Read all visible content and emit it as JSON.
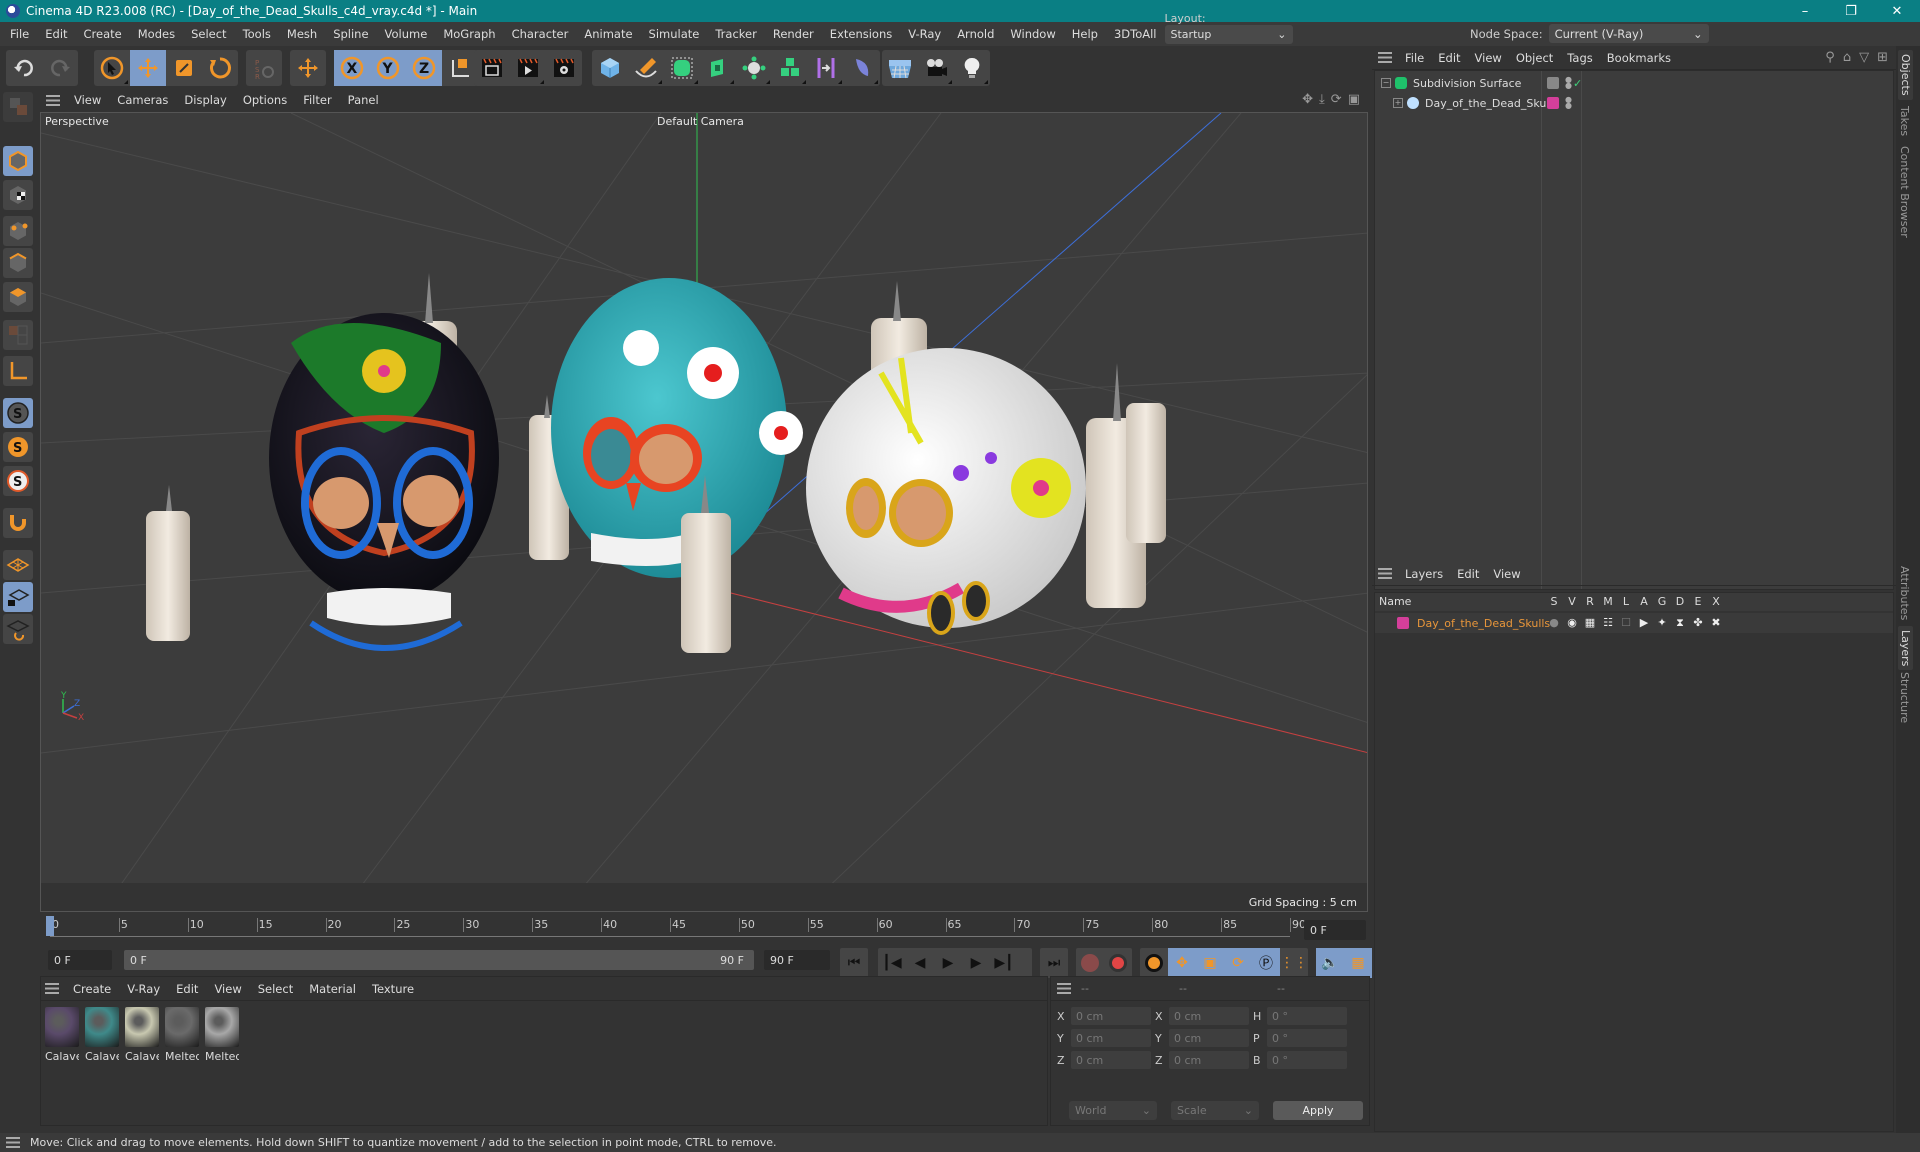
{
  "window": {
    "title": "Cinema 4D R23.008 (RC) - [Day_of_the_Dead_Skulls_c4d_vray.c4d *] - Main",
    "controls": [
      "minimize",
      "restore",
      "close"
    ]
  },
  "menubar": {
    "items": [
      "File",
      "Edit",
      "Create",
      "Modes",
      "Select",
      "Tools",
      "Mesh",
      "Spline",
      "Volume",
      "MoGraph",
      "Character",
      "Animate",
      "Simulate",
      "Tracker",
      "Render",
      "Extensions",
      "V-Ray",
      "Arnold",
      "Window",
      "Help",
      "3DToAll"
    ],
    "node_space_label": "Node Space:",
    "node_space_value": "Current (V-Ray)",
    "layout_label": "Layout:",
    "layout_value": "Startup"
  },
  "toolbar": {
    "groups": [
      [
        "undo-icon",
        "redo-icon"
      ],
      [
        "select-arrow-icon",
        "move-icon",
        "scale-icon",
        "rotate-icon"
      ],
      [
        "psr-icon"
      ],
      [
        "move-alt-icon"
      ],
      [
        "x-axis-icon",
        "y-axis-icon",
        "z-axis-icon"
      ],
      [
        "coordinate-system-icon"
      ],
      [
        "render-view-icon",
        "render-picture-viewer-icon",
        "render-settings-icon"
      ],
      [
        "cube-icon",
        "pen-spline-icon",
        "subdivision-generator-icon",
        "extrude-icon",
        "mograph-cloner-icon",
        "array-icon",
        "symmetry-deformer-icon",
        "field-icon"
      ],
      [
        "floor-icon",
        "camera-icon",
        "light-icon"
      ]
    ],
    "selected": [
      "move-icon",
      "x-axis-icon",
      "y-axis-icon",
      "z-axis-icon"
    ]
  },
  "left_tools": {
    "items": [
      "model-mode",
      "texture-mode",
      "point-mode",
      "edge-mode",
      "polygon-mode",
      "uv-mode",
      "axis-mode",
      "solo-off",
      "solo-single",
      "solo-hierarchy",
      "snap",
      "workplane",
      "workplane-lock",
      "workplane-sync"
    ],
    "selected": [
      "model-mode",
      "solo-off",
      "workplane-lock"
    ]
  },
  "viewport": {
    "menu": [
      "View",
      "Cameras",
      "Display",
      "Options",
      "Filter",
      "Panel"
    ],
    "view_name": "Perspective",
    "camera": "Default Camera",
    "grid_spacing": "Grid Spacing : 5 cm",
    "axis_labels": {
      "x": "X",
      "y": "Y",
      "z": "Z"
    },
    "scene_objects": [
      "black-beaded-skull",
      "turquoise-skull",
      "white-sugar-skull",
      "candles"
    ]
  },
  "timeline": {
    "ticks": [
      "0",
      "5",
      "10",
      "15",
      "20",
      "25",
      "30",
      "35",
      "40",
      "45",
      "50",
      "55",
      "60",
      "65",
      "70",
      "75",
      "80",
      "85",
      "90"
    ],
    "current_frame": "0 F",
    "start_field": "0 F",
    "range_start": "0 F",
    "range_end": "90 F",
    "end_field": "90 F",
    "playhead_fraction": 0
  },
  "transport": {
    "buttons": [
      "go-to-start",
      "previous-key",
      "previous-frame",
      "play",
      "next-frame",
      "next-key",
      "go-to-end"
    ],
    "record_buttons": [
      "record-off",
      "autokey"
    ],
    "key_buttons": [
      "keyframe-selection",
      "key-position",
      "key-scale",
      "key-rotation",
      "key-parameter",
      "key-pla"
    ],
    "extra_buttons": [
      "sound",
      "timeline-window"
    ]
  },
  "materials": {
    "menu": [
      "Create",
      "V-Ray",
      "Edit",
      "View",
      "Select",
      "Material",
      "Texture"
    ],
    "items": [
      {
        "label": "Calavera",
        "swatch": "#5a4a6a"
      },
      {
        "label": "Calavera",
        "swatch": "#3f8a8a"
      },
      {
        "label": "Calavera",
        "swatch": "#c8c8b0"
      },
      {
        "label": "Melted_(",
        "swatch": "#6a6a6a"
      },
      {
        "label": "Melted_(",
        "swatch": "#a8a8a8"
      }
    ]
  },
  "coordinates": {
    "headers": [
      "--",
      "--",
      "--"
    ],
    "rows": [
      {
        "l1": "X",
        "v1": "0 cm",
        "l2": "X",
        "v2": "0 cm",
        "l3": "H",
        "v3": "0 °"
      },
      {
        "l1": "Y",
        "v1": "0 cm",
        "l2": "Y",
        "v2": "0 cm",
        "l3": "P",
        "v3": "0 °"
      },
      {
        "l1": "Z",
        "v1": "0 cm",
        "l2": "Z",
        "v2": "0 cm",
        "l3": "B",
        "v3": "0 °"
      }
    ],
    "space": "World",
    "mode": "Scale",
    "apply": "Apply"
  },
  "objects_panel": {
    "menu": [
      "File",
      "Edit",
      "View",
      "Object",
      "Tags",
      "Bookmarks"
    ],
    "items": [
      {
        "name": "Subdivision Surface",
        "color": "#1fc16b",
        "indent": 0,
        "expander": "minus"
      },
      {
        "name": "Day_of_the_Dead_Skulls",
        "color": "#d43f9a",
        "indent": 1,
        "expander": "plus"
      }
    ]
  },
  "layers_panel": {
    "menu": [
      "Layers",
      "Edit",
      "View"
    ],
    "columns": [
      "Name",
      "S",
      "V",
      "R",
      "M",
      "L",
      "A",
      "G",
      "D",
      "E",
      "X"
    ],
    "items": [
      {
        "name": "Day_of_the_Dead_Skulls",
        "color": "#d43f9a"
      }
    ]
  },
  "side_tabs": {
    "top": [
      "Objects",
      "Takes",
      "Content Browser"
    ],
    "bottom": [
      "Attributes",
      "Layers",
      "Structure"
    ]
  },
  "statusbar": {
    "text": "Move: Click and drag to move elements. Hold down SHIFT to quantize movement / add to the selection in point mode, CTRL to remove."
  },
  "colors": {
    "titlebar": "#0a7f84",
    "accent_selected": "#7d9cc9",
    "icon_orange": "#f0962a",
    "layer_name": "#e8963a"
  }
}
